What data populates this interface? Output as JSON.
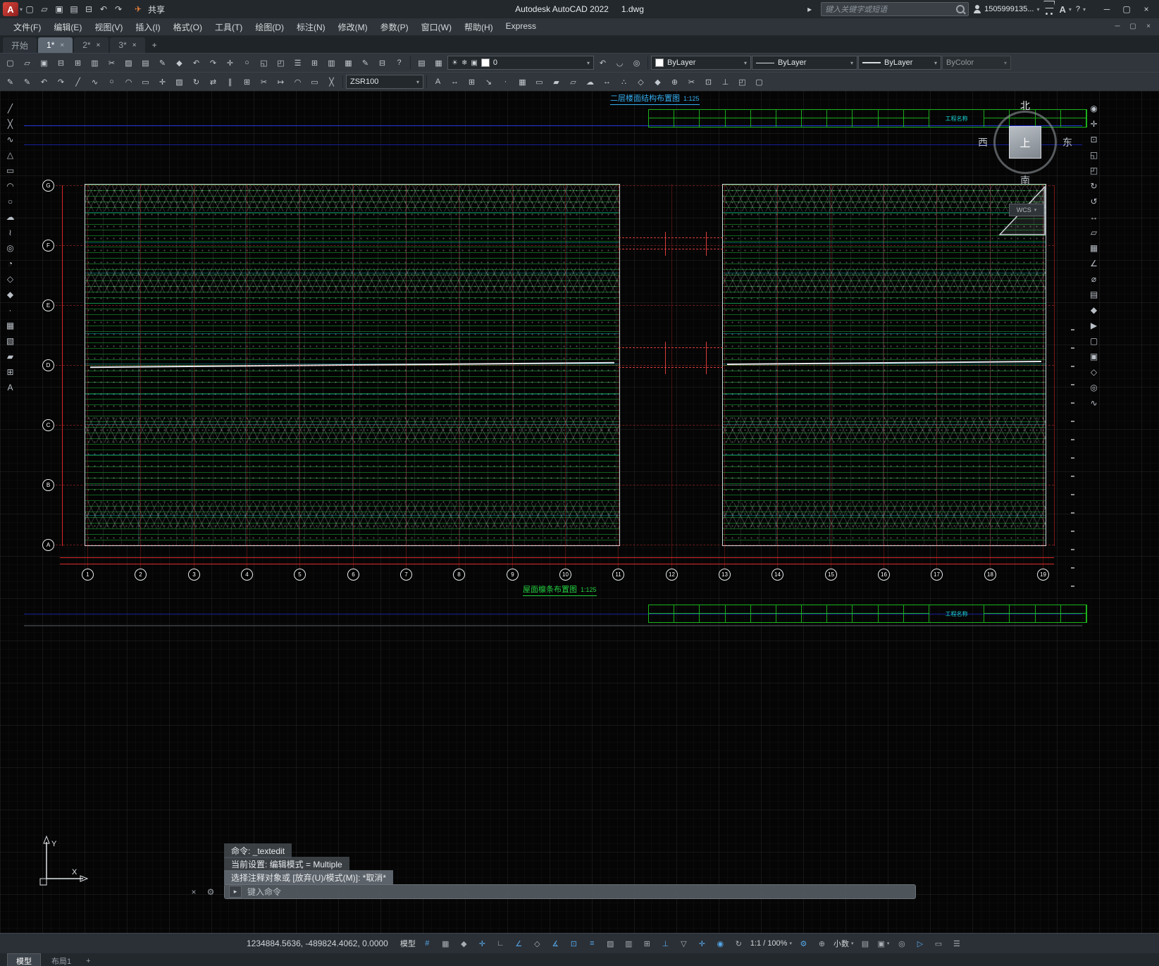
{
  "titlebar": {
    "share_label": "共享",
    "app_title": "Autodesk AutoCAD 2022",
    "doc_title": "1.dwg",
    "search_placeholder": "键入关键字或短语",
    "username": "1505999135...",
    "help_label": "?",
    "qat_icons": [
      "new",
      "open",
      "save",
      "saveas",
      "plot",
      "undo",
      "redo"
    ]
  },
  "window_controls": [
    "minimize",
    "restore",
    "close"
  ],
  "menubar": {
    "items": [
      "文件(F)",
      "编辑(E)",
      "视图(V)",
      "插入(I)",
      "格式(O)",
      "工具(T)",
      "绘图(D)",
      "标注(N)",
      "修改(M)",
      "参数(P)",
      "窗口(W)",
      "帮助(H)",
      "Express"
    ]
  },
  "filetabs": {
    "tabs": [
      {
        "label": "开始",
        "active": false,
        "closable": false
      },
      {
        "label": "1*",
        "active": true,
        "closable": true
      },
      {
        "label": "2*",
        "active": false,
        "closable": true
      },
      {
        "label": "3*",
        "active": false,
        "closable": true
      }
    ],
    "new_tab_label": "+"
  },
  "toolbars": {
    "row1_icons": [
      "new",
      "open",
      "save",
      "plot",
      "plot-preview",
      "publish",
      "cut",
      "copy",
      "paste",
      "matchprops",
      "block-editor",
      "undo",
      "redo",
      "pan",
      "zoom-realtime",
      "zoom-window",
      "zoom-previous",
      "properties",
      "designcenter",
      "tool-palettes",
      "sheet-set",
      "markup",
      "calculator",
      "help"
    ],
    "layer_icons_pre": [
      "layer-properties",
      "layer-states"
    ],
    "layer_value": "0",
    "layer_icons_post": [
      "layer-previous",
      "layer-unlock",
      "layer-isolate"
    ],
    "color_value": "ByLayer",
    "linetype_value": "ByLayer",
    "lineweight_value": "ByLayer",
    "plotstyle_value": "ByColor",
    "row2_icons_left": [
      "match-properties",
      "annotation-matchprops",
      "undo-small",
      "redo-small",
      "line2",
      "pline2",
      "circle2",
      "arc2",
      "rect2",
      "move",
      "copy-obj",
      "rotate",
      "mirror",
      "offset",
      "array",
      "trim",
      "extend",
      "fillet",
      "erase",
      "explode"
    ],
    "text_style_value": "ZSR100",
    "row2_icons_right": [
      "text-style",
      "dim-style",
      "table-style",
      "mleader-style",
      "point-style",
      "hatch-edit",
      "boundary",
      "region-tool",
      "wipeout",
      "revcloud-tool",
      "measure",
      "divide",
      "insert-block",
      "make-block",
      "attach-xref",
      "clip-xref",
      "osnap-settings",
      "ucs-tool",
      "view-previous",
      "named-views"
    ]
  },
  "palettes": {
    "draw": [
      "line",
      "construction-line",
      "polyline",
      "polygon",
      "rectangle",
      "arc",
      "circle",
      "revision-cloud",
      "spline",
      "ellipse",
      "ellipse-arc",
      "insert-block",
      "make-block",
      "point",
      "hatch",
      "gradient",
      "region",
      "table",
      "multiline-text"
    ],
    "nav": [
      "full-navigation-wheel",
      "pan",
      "zoom-extents",
      "zoom-window",
      "zoom-previous",
      "orbit",
      "free-orbit",
      "distance",
      "area",
      "volume",
      "measure-angle",
      "quick-measure",
      "section",
      "steering",
      "show-motion",
      "view-front",
      "view-top",
      "view-iso",
      "camera",
      "motion-path"
    ]
  },
  "viewcube": {
    "north": "北",
    "west": "西",
    "east": "东",
    "south": "南",
    "top": "上",
    "wcs_label": "WCS"
  },
  "drawing": {
    "top_title": "二层楼面结构布置图",
    "top_scale": "1:125",
    "bottom_title": "屋面檩条布置图",
    "bottom_scale": "1:125",
    "table_label": "工程名称",
    "ucs_x": "X",
    "ucs_y": "Y",
    "col_bubbles": [
      "1",
      "2",
      "3",
      "4",
      "5",
      "6",
      "7",
      "8",
      "9",
      "10",
      "11",
      "12",
      "13",
      "14",
      "15",
      "16",
      "17",
      "18",
      "19"
    ],
    "row_bubbles": [
      "G",
      "F",
      "E",
      "D",
      "C",
      "B",
      "A"
    ]
  },
  "command": {
    "history": [
      {
        "text": "命令: _textedit",
        "highlight": false
      },
      {
        "text": "当前设置: 编辑模式 = Multiple",
        "highlight": false
      },
      {
        "text": "选择注释对象或 [放弃(U)/模式(M)]: *取消*",
        "highlight": true
      }
    ],
    "input_placeholder": "键入命令"
  },
  "statusbar": {
    "coords": "1234884.5636, -489824.4062, 0.0000",
    "items": [
      {
        "name": "model-space",
        "text": "模型"
      },
      {
        "name": "grid",
        "active": true
      },
      {
        "name": "snap-mode"
      },
      {
        "name": "infer-constraints"
      },
      {
        "name": "dynamic-input",
        "active": true
      },
      {
        "name": "ortho-mode"
      },
      {
        "name": "polar-tracking",
        "active": true
      },
      {
        "name": "isometric-drafting"
      },
      {
        "name": "object-snap-tracking",
        "active": true
      },
      {
        "name": "object-snap",
        "active": true
      },
      {
        "name": "lineweight-display",
        "active": true
      },
      {
        "name": "transparency"
      },
      {
        "name": "selection-cycling"
      },
      {
        "name": "3d-object-snap"
      },
      {
        "name": "dynamic-ucs",
        "active": true
      },
      {
        "name": "selection-filtering"
      },
      {
        "name": "gizmo",
        "active": true
      },
      {
        "name": "annotation-visibility",
        "active": true
      },
      {
        "name": "autoscale"
      },
      {
        "name": "annotation-scale",
        "text": "1:1 / 100%",
        "caret": true
      },
      {
        "name": "workspace-switching",
        "active": true
      },
      {
        "name": "annotation-monitor"
      },
      {
        "name": "units",
        "text": "小数",
        "caret": true
      },
      {
        "name": "quick-properties"
      },
      {
        "name": "lock-ui",
        "caret": true
      },
      {
        "name": "isolate-objects"
      },
      {
        "name": "graphics-performance",
        "active": true
      },
      {
        "name": "clean-screen"
      },
      {
        "name": "customize"
      }
    ]
  },
  "layoutbar": {
    "tabs": [
      {
        "label": "模型",
        "active": true
      },
      {
        "label": "布局1",
        "active": false
      }
    ],
    "new_label": "+"
  }
}
